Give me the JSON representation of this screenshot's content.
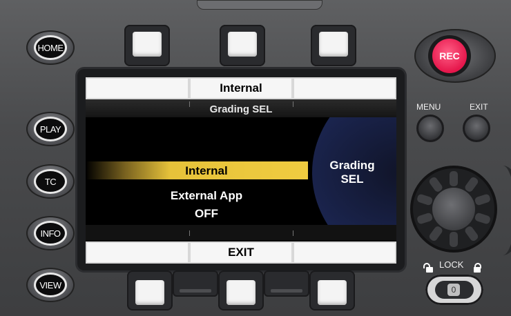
{
  "side_buttons": [
    {
      "key": "home",
      "label": "HOME"
    },
    {
      "key": "play",
      "label": "PLAY"
    },
    {
      "key": "tc",
      "label": "TC"
    },
    {
      "key": "info",
      "label": "INFO"
    },
    {
      "key": "view",
      "label": "VIEW"
    }
  ],
  "screen": {
    "top_tabs": {
      "left": "",
      "center": "Internal",
      "right": ""
    },
    "header": "Grading SEL",
    "options": [
      {
        "label": "Internal",
        "selected": true
      },
      {
        "label": "External App",
        "selected": false
      },
      {
        "label": "OFF",
        "selected": false
      }
    ],
    "side_panel": {
      "line1": "Grading",
      "line2": "SEL"
    },
    "bottom_tabs": {
      "left": "",
      "center": "EXIT",
      "right": ""
    }
  },
  "right_panel": {
    "rec_label": "REC",
    "menu_label": "MENU",
    "exit_label": "EXIT",
    "lock_label": "LOCK",
    "lock_switch_mark": "0"
  },
  "colors": {
    "rec": "#e5164b",
    "highlight": "#f0cc40",
    "panel": "#4a4b4d"
  }
}
